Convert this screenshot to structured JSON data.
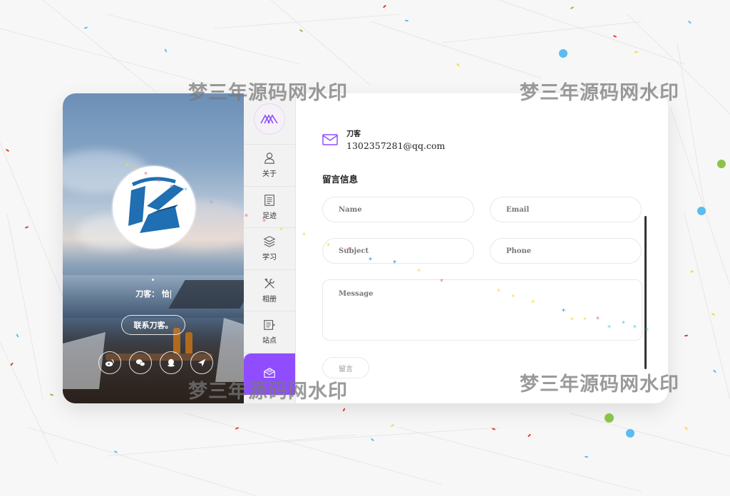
{
  "watermark": {
    "text": "梦三年源码网水印"
  },
  "profile": {
    "typing_text": "刀客：  恰",
    "contact_label": "联系刀客。",
    "socials": [
      {
        "icon": "weibo-icon"
      },
      {
        "icon": "wechat-icon"
      },
      {
        "icon": "qq-icon"
      },
      {
        "icon": "send-icon"
      }
    ]
  },
  "nav": {
    "logo_icon": "mountain-logo-icon",
    "items": [
      {
        "label": "关于",
        "icon": "user-icon"
      },
      {
        "label": "足迹",
        "icon": "document-icon"
      },
      {
        "label": "学习",
        "icon": "layers-icon"
      },
      {
        "label": "相册",
        "icon": "tools-icon"
      },
      {
        "label": "站点",
        "icon": "sites-icon"
      },
      {
        "label": "",
        "icon": "mail-open-icon",
        "active": true
      }
    ]
  },
  "contact": {
    "name": "刀客",
    "email": "1302357281@qq.com",
    "section_title": "留言信息",
    "placeholders": {
      "name": "Name",
      "email": "Email",
      "subject": "Subject",
      "phone": "Phone",
      "message": "Message"
    },
    "submit_label": "留言"
  },
  "colors": {
    "accent": "#8f4dff",
    "background": "#f7f7f7"
  }
}
